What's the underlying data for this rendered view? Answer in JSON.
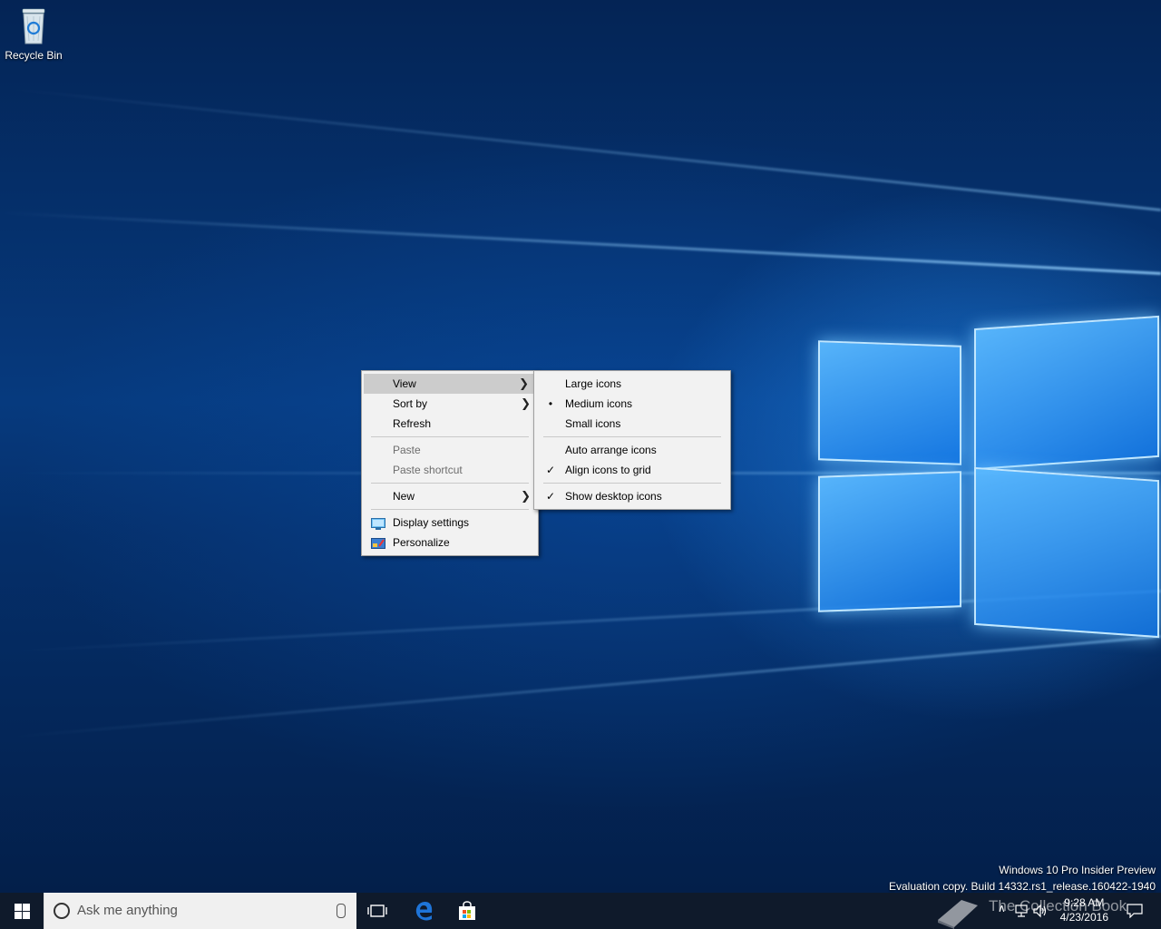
{
  "desktop": {
    "icons": [
      {
        "label": "Recycle Bin",
        "icon": "recycle-bin-icon"
      }
    ],
    "watermark": {
      "line1": "Windows 10 Pro Insider Preview",
      "line2": "Evaluation copy. Build 14332.rs1_release.160422-1940"
    }
  },
  "context_menu": {
    "items": [
      {
        "label": "View",
        "has_submenu": true,
        "highlighted": true
      },
      {
        "label": "Sort by",
        "has_submenu": true
      },
      {
        "label": "Refresh"
      },
      {
        "label": "Paste",
        "disabled": true
      },
      {
        "label": "Paste shortcut",
        "disabled": true
      },
      {
        "label": "New",
        "has_submenu": true
      },
      {
        "label": "Display settings",
        "icon": "display-settings-icon"
      },
      {
        "label": "Personalize",
        "icon": "personalize-icon"
      }
    ]
  },
  "view_submenu": {
    "items": [
      {
        "label": "Large icons"
      },
      {
        "label": "Medium icons",
        "selected": true,
        "mark": "•"
      },
      {
        "label": "Small icons"
      },
      {
        "label": "Auto arrange icons"
      },
      {
        "label": "Align icons to grid",
        "checked": true,
        "mark": "✓"
      },
      {
        "label": "Show desktop icons",
        "checked": true,
        "mark": "✓"
      }
    ]
  },
  "taskbar": {
    "search_placeholder": "Ask me anything",
    "clock_time": "9:28 AM",
    "clock_date": "4/23/2016",
    "overlay_text": "The Collection Book"
  },
  "colors": {
    "menu_bg": "#f2f2f2",
    "menu_hover": "#cccccc",
    "taskbar": "#0f1a2b",
    "edge_blue": "#1e74d8"
  }
}
